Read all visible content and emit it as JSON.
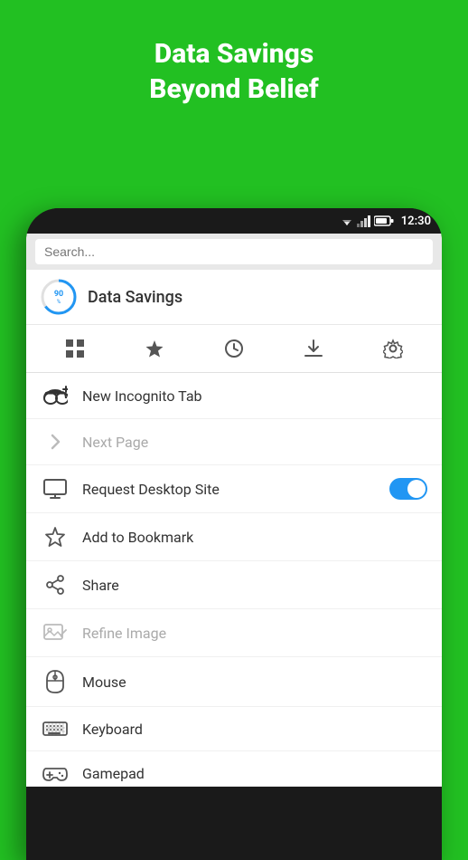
{
  "header": {
    "title_line1": "Data Savings",
    "title_line2": "Beyond Belief"
  },
  "status_bar": {
    "time": "12:30"
  },
  "browser": {
    "search_placeholder": "Search...",
    "data_savings_title": "Data Savings",
    "savings_percent": "90",
    "savings_unit": "%"
  },
  "menu_items": [
    {
      "id": "new-incognito-tab",
      "label": "New Incognito Tab",
      "disabled": false,
      "has_toggle": false,
      "icon": "incognito"
    },
    {
      "id": "next-page",
      "label": "Next Page",
      "disabled": true,
      "has_toggle": false,
      "icon": "chevron"
    },
    {
      "id": "request-desktop-site",
      "label": "Request Desktop Site",
      "disabled": false,
      "has_toggle": true,
      "icon": "desktop"
    },
    {
      "id": "add-to-bookmark",
      "label": "Add to Bookmark",
      "disabled": false,
      "has_toggle": false,
      "icon": "star"
    },
    {
      "id": "share",
      "label": "Share",
      "disabled": false,
      "has_toggle": false,
      "icon": "share"
    },
    {
      "id": "refine-image",
      "label": "Refine Image",
      "disabled": true,
      "has_toggle": false,
      "icon": "image"
    },
    {
      "id": "mouse",
      "label": "Mouse",
      "disabled": false,
      "has_toggle": false,
      "icon": "mouse"
    },
    {
      "id": "keyboard",
      "label": "Keyboard",
      "disabled": false,
      "has_toggle": false,
      "icon": "keyboard"
    },
    {
      "id": "gamepad",
      "label": "Gamepad",
      "disabled": false,
      "has_toggle": false,
      "icon": "gamepad"
    }
  ],
  "toolbar": {
    "icons": [
      "grid",
      "star",
      "clock",
      "download",
      "settings"
    ]
  }
}
